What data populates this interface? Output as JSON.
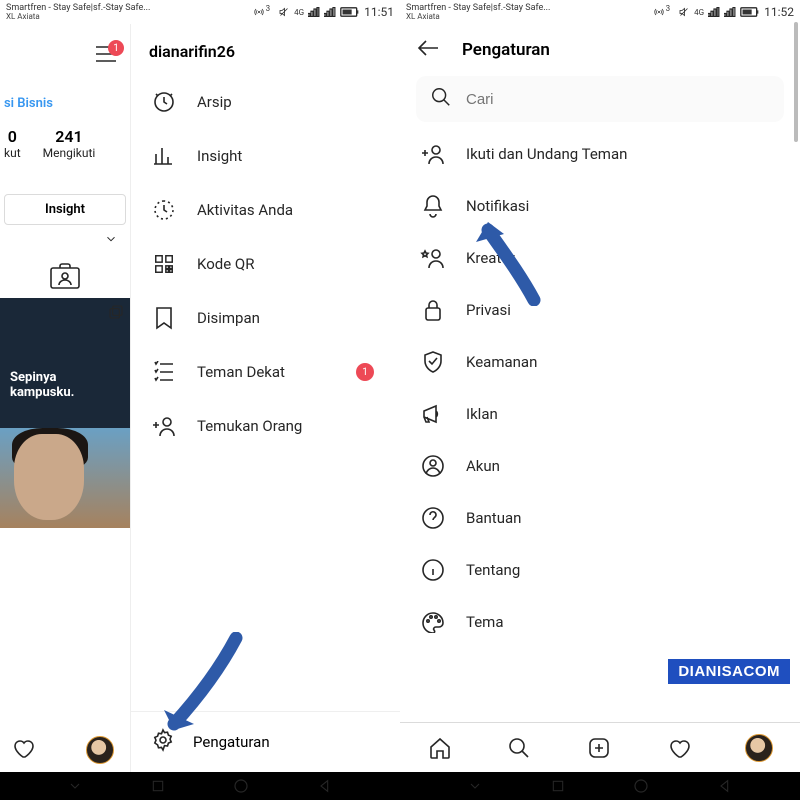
{
  "status": {
    "carrier_line1": "Smartfren - Stay Safe|sf.-Stay Safe...",
    "carrier_line2": "XL Axiata",
    "net_label": "4G",
    "hotspot_label": "3",
    "time_left": "11:51",
    "time_right": "11:52"
  },
  "left": {
    "hamburger_badge": "1",
    "business_link": "si Bisnis",
    "stat1_num": "0",
    "stat1_label": "kut",
    "stat2_num": "241",
    "stat2_label": "Mengikuti",
    "insight_button": "Insight",
    "thumb_caption": "Sepinya kampusku."
  },
  "drawer": {
    "username": "dianarifin26",
    "items": [
      {
        "name": "archive",
        "label": "Arsip"
      },
      {
        "name": "insight",
        "label": "Insight"
      },
      {
        "name": "activity",
        "label": "Aktivitas Anda"
      },
      {
        "name": "qr",
        "label": "Kode QR"
      },
      {
        "name": "saved",
        "label": "Disimpan"
      },
      {
        "name": "close-friends",
        "label": "Teman Dekat",
        "badge": "1"
      },
      {
        "name": "discover",
        "label": "Temukan Orang"
      }
    ],
    "footer_label": "Pengaturan"
  },
  "settings": {
    "title": "Pengaturan",
    "search_placeholder": "Cari",
    "items": [
      {
        "name": "invite",
        "label": "Ikuti dan Undang Teman"
      },
      {
        "name": "notifications",
        "label": "Notifikasi"
      },
      {
        "name": "creator",
        "label": "Kreator"
      },
      {
        "name": "privacy",
        "label": "Privasi"
      },
      {
        "name": "security",
        "label": "Keamanan"
      },
      {
        "name": "ads",
        "label": "Iklan"
      },
      {
        "name": "account",
        "label": "Akun"
      },
      {
        "name": "help",
        "label": "Bantuan"
      },
      {
        "name": "about",
        "label": "Tentang"
      },
      {
        "name": "theme",
        "label": "Tema"
      }
    ]
  },
  "watermark": "DIANISACOM"
}
